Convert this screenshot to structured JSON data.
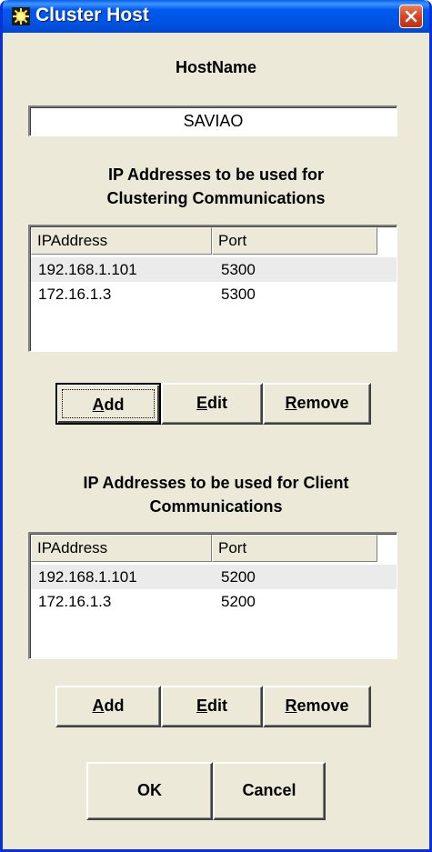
{
  "window": {
    "title": "Cluster Host"
  },
  "hostname": {
    "label": "HostName",
    "value": "SAVIAO"
  },
  "clustering": {
    "title_line1": "IP Addresses to be used for",
    "title_line2": "Clustering Communications",
    "columns": [
      "IPAddress",
      "Port"
    ],
    "rows": [
      {
        "ip": "192.168.1.101",
        "port": "5300",
        "selected": true
      },
      {
        "ip": "172.16.1.3",
        "port": "5300",
        "selected": false
      }
    ],
    "buttons": {
      "add_mnemonic": "A",
      "add_rest": "dd",
      "edit_mnemonic": "E",
      "edit_rest": "dit",
      "remove_mnemonic": "R",
      "remove_rest": "emove"
    }
  },
  "client": {
    "title_line1": "IP Addresses to be used for Client",
    "title_line2": "Communications",
    "columns": [
      "IPAddress",
      "Port"
    ],
    "rows": [
      {
        "ip": "192.168.1.101",
        "port": "5200",
        "selected": true
      },
      {
        "ip": "172.16.1.3",
        "port": "5200",
        "selected": false
      }
    ],
    "buttons": {
      "add_mnemonic": "A",
      "add_rest": "dd",
      "edit_mnemonic": "E",
      "edit_rest": "dit",
      "remove_mnemonic": "R",
      "remove_rest": "emove"
    }
  },
  "footer": {
    "ok_label": "OK",
    "cancel_label": "Cancel"
  },
  "colors": {
    "titlebar": "#0054e3",
    "window_bg": "#ece9d8",
    "close_button": "#d6451f"
  },
  "icons": {
    "app": "sun-icon",
    "close": "close-icon"
  }
}
